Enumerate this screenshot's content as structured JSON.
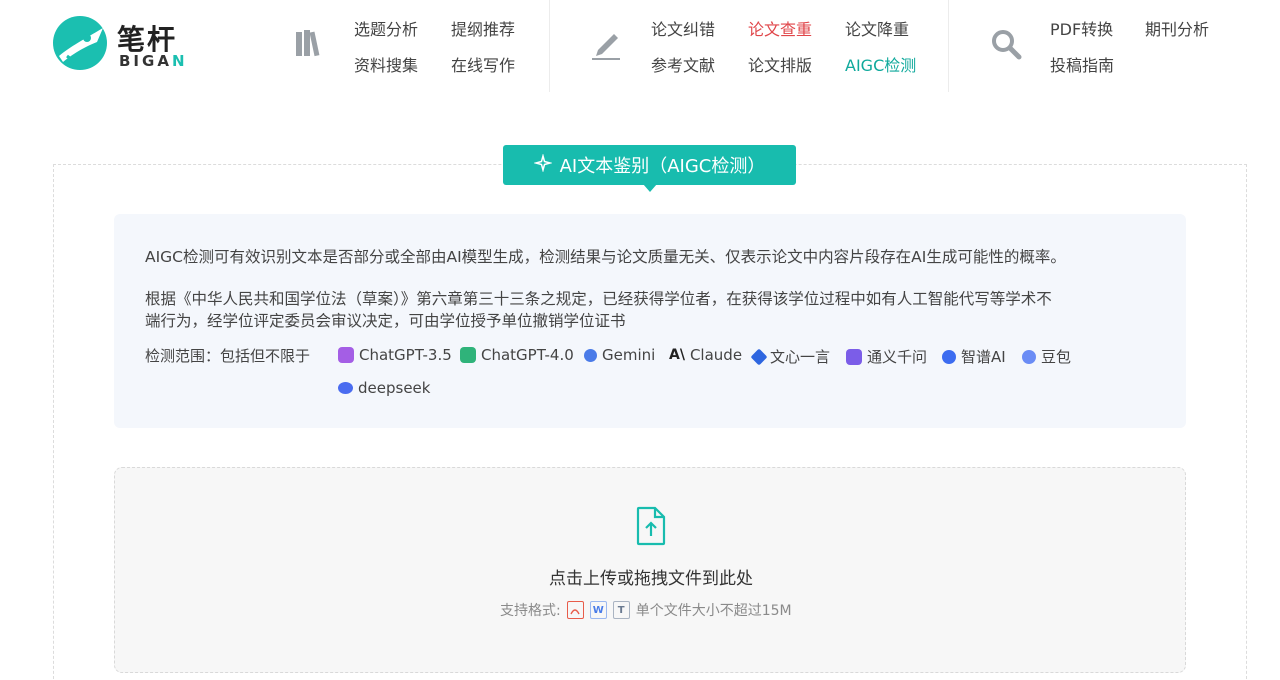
{
  "logo": {
    "cn": "笔杆",
    "en_main": "BIGA",
    "en_accent": "N"
  },
  "nav": {
    "group1": [
      "选题分析",
      "提纲推荐",
      "资料搜集",
      "在线写作"
    ],
    "group2": [
      "论文纠错",
      "论文查重",
      "论文降重",
      "参考文献",
      "论文排版",
      "AIGC检测"
    ],
    "group3": [
      "PDF转换",
      "期刊分析",
      "投稿指南"
    ]
  },
  "badge": {
    "label": "AI文本鉴别（AIGC检测）"
  },
  "info": {
    "para1": "AIGC检测可有效识别文本是否部分或全部由AI模型生成，检测结果与论文质量无关、仅表示论文中内容片段存在AI生成可能性的概率。",
    "para2_line1": "根据《中华人民共和国学位法（草案）》第六章第三十三条之规定，已经获得学位者，在获得该学位过程中如有人工智能代写等学术不",
    "para2_line2": "端行为，经学位评定委员会审议决定，可由学位授予单位撤销学位证书",
    "scope_label": "检测范围：包括但不限于",
    "models": [
      "ChatGPT-3.5",
      "ChatGPT-4.0",
      "Gemini",
      "Claude",
      "文心一言",
      "通义千问",
      "智谱AI",
      "豆包",
      "deepseek"
    ]
  },
  "upload": {
    "title": "点击上传或拖拽文件到此处",
    "formats_label": "支持格式:",
    "formats": [
      "PDF",
      "W",
      "T"
    ],
    "size_note": "单个文件大小不超过15M"
  },
  "colors": {
    "accent": "#18bcae",
    "red": "#e0464a",
    "panel_bg": "#f4f7fc"
  }
}
